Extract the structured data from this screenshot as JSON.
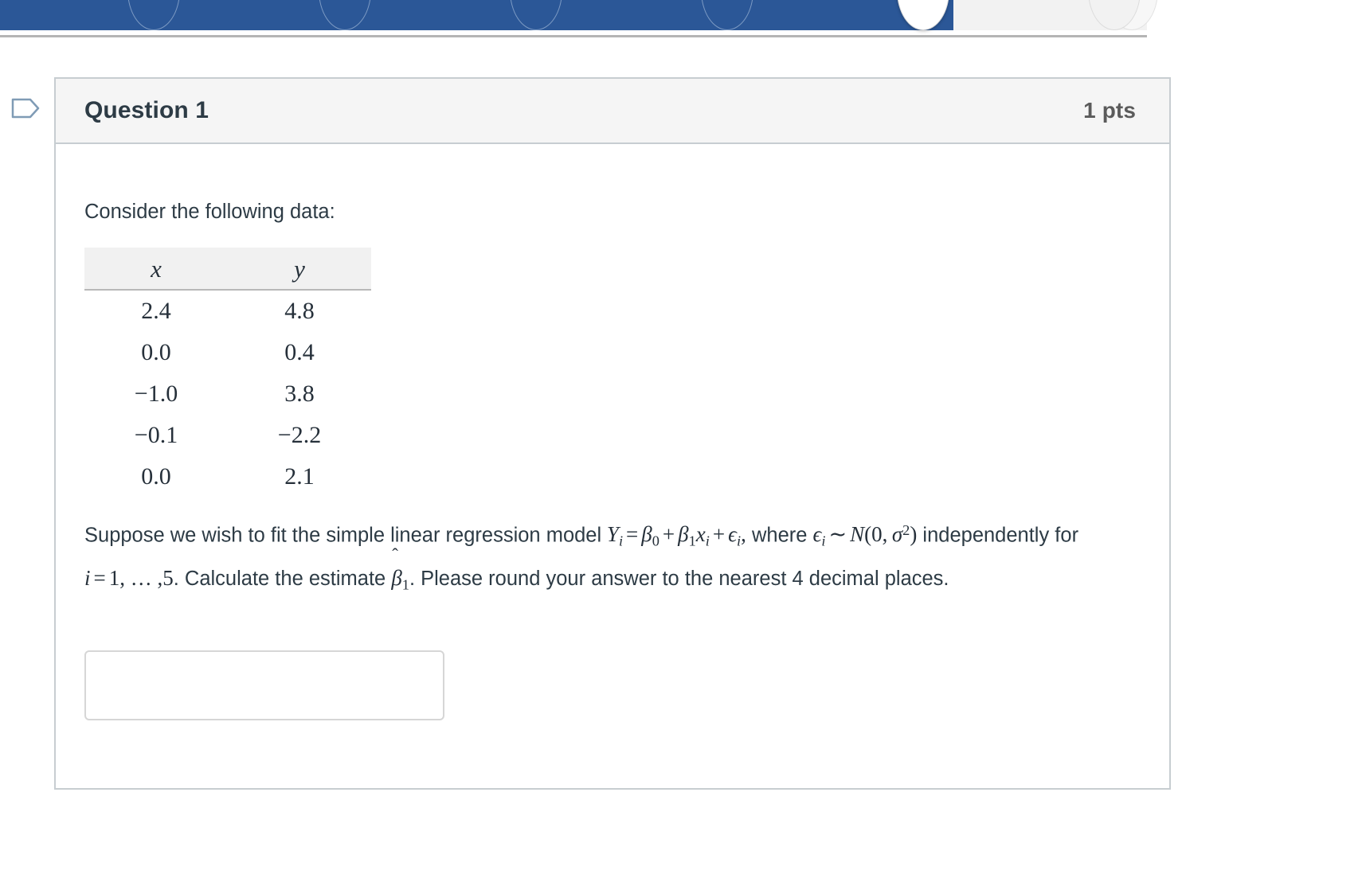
{
  "browser": {
    "tabs": [
      {
        "name": "tab-1",
        "icon": "document-icon",
        "state": "background"
      },
      {
        "name": "tab-2",
        "icon": "document-icon",
        "state": "background"
      },
      {
        "name": "tab-3",
        "icon": "document-icon",
        "state": "background"
      },
      {
        "name": "tab-4",
        "icon": "document-icon",
        "state": "background"
      },
      {
        "name": "tab-5",
        "icon": "muted-speaker-icon",
        "state": "active"
      },
      {
        "name": "tab-6",
        "icon": "document-icon",
        "state": "background"
      }
    ],
    "accent_color": "#2b5797",
    "inactive_color": "#f2f2f2"
  },
  "gutter": {
    "flag_icon": "question-flag-icon"
  },
  "question": {
    "title": "Question 1",
    "points": "1 pts",
    "header_bg": "#f5f5f5",
    "border_color": "#c7cdd1",
    "intro": "Consider the following data:",
    "table": {
      "headers": [
        "x",
        "y"
      ],
      "rows": [
        [
          "2.4",
          "4.8"
        ],
        [
          "0.0",
          "0.4"
        ],
        [
          "−1.0",
          "3.8"
        ],
        [
          "−0.1",
          "−2.2"
        ],
        [
          "0.0",
          "2.1"
        ]
      ]
    },
    "body": {
      "line1_pre": "Suppose we wish to fit the simple linear regression model",
      "formula_model": {
        "lhs_var": "Y",
        "lhs_sub": "i",
        "eq": "=",
        "b0_var": "β",
        "b0_sub": "0",
        "plus1": "+",
        "b1_var": "β",
        "b1_sub": "1",
        "x_var": "x",
        "x_sub": "i",
        "plus2": "+",
        "eps_var": "ϵ",
        "eps_sub": "i",
        "comma": ","
      },
      "line1_post": "where",
      "formula_error": {
        "eps_var": "ϵ",
        "eps_sub": "i",
        "tilde": "∼",
        "N": "N",
        "open": "(",
        "zero": "0",
        "comma": ",",
        "sigma": "σ",
        "sigma_sup": "2",
        "close": ")"
      },
      "line2_mid": "independently for",
      "formula_index": {
        "i_var": "i",
        "eq": "=",
        "one": "1",
        "dots": ", … ,",
        "five": "5"
      },
      "line2_post": ". Calculate the estimate",
      "formula_betahat": {
        "hat": "ˆ",
        "var": "β",
        "sub": "1"
      },
      "line3_pre": ". Please round your",
      "line3": "answer to the nearest 4 decimal places."
    },
    "answer": {
      "value": "",
      "placeholder": ""
    }
  }
}
